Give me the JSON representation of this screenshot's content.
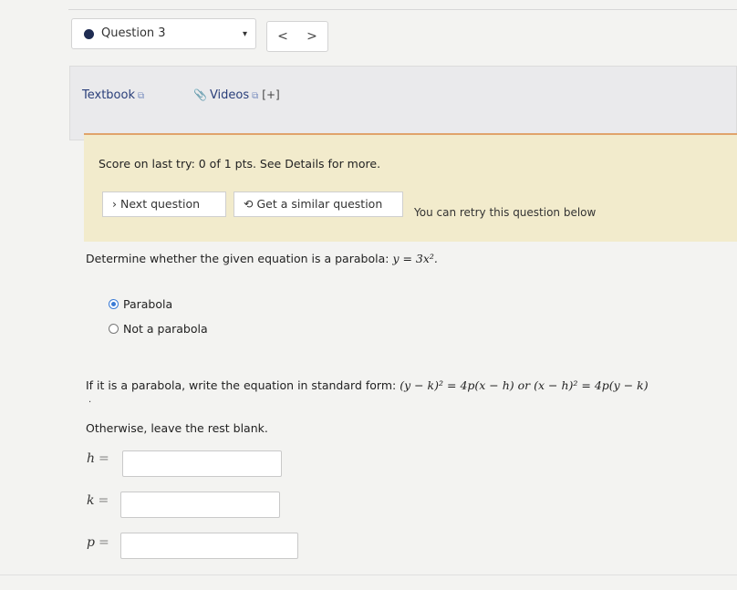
{
  "question_nav": {
    "label": "Question 3",
    "prev": "<",
    "next": ">",
    "caret": "▾"
  },
  "resources": {
    "textbook": "Textbook",
    "videos": "Videos",
    "videos_toggle": "[+]"
  },
  "score": {
    "text": "Score on last try: 0 of 1 pts. See Details for more.",
    "next_question": "Next question",
    "similar_question": "Get a similar question",
    "retry_note": "You can retry this question below"
  },
  "question": {
    "prompt": "Determine whether the given equation is a parabola:",
    "equation": "y = 3x².",
    "options": [
      "Parabola",
      "Not a parabola"
    ],
    "selected": "Parabola",
    "instruction": "If it is a parabola, write the equation in standard form:",
    "standard_forms": "(y − k)² = 4p(x − h) or (x − h)² = 4p(y − k)",
    "otherwise": "Otherwise, leave the rest blank."
  },
  "fields": [
    {
      "label": "h",
      "value": ""
    },
    {
      "label": "k",
      "value": ""
    },
    {
      "label": "p",
      "value": ""
    }
  ],
  "colors": {
    "score_bg": "#f2ebcc",
    "score_border": "#e0a36b",
    "link": "#2a3f7a",
    "radio_checked": "#3a7bd5"
  }
}
